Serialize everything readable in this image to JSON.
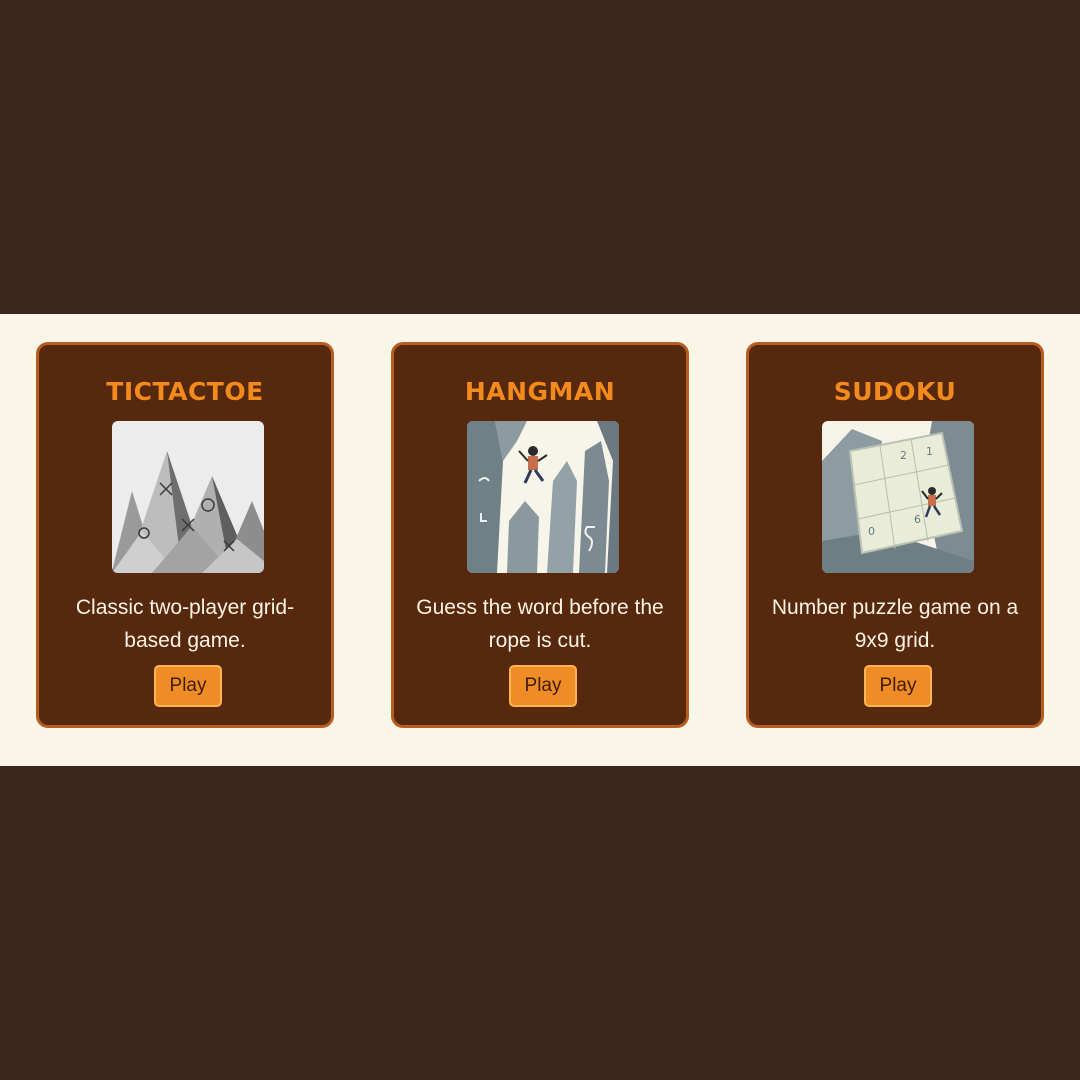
{
  "games": [
    {
      "title": "TICTACTOE",
      "description": "Classic two-player grid-based game.",
      "button_label": "Play",
      "image_name": "tictactoe-mountains-illustration"
    },
    {
      "title": "HANGMAN",
      "description": "Guess the word before the rope is cut.",
      "button_label": "Play",
      "image_name": "hangman-climber-illustration"
    },
    {
      "title": "SUDOKU",
      "description": "Number puzzle game on a 9x9 grid.",
      "button_label": "Play",
      "image_name": "sudoku-cliff-grid-illustration"
    }
  ],
  "colors": {
    "page_background": "#3d271d",
    "band_background": "#f9f6e8",
    "card_background": "#56280d",
    "card_border": "#b75d1f",
    "title": "#f28a1d",
    "description": "#fdf3e4",
    "button": "#f08c25"
  }
}
